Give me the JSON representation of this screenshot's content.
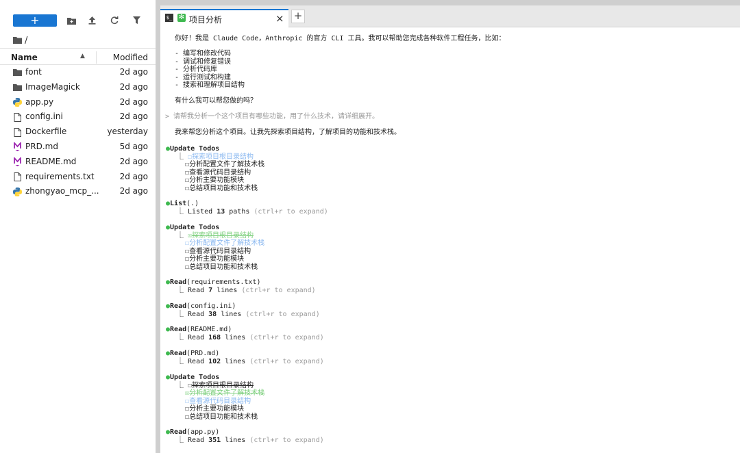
{
  "file_browser": {
    "new_label": "+",
    "breadcrumb": "/",
    "col_name": "Name",
    "col_modified": "Modified",
    "files": [
      {
        "name": "font",
        "icon": "folder-icon",
        "modified": "2d ago"
      },
      {
        "name": "ImageMagick",
        "icon": "folder-icon",
        "modified": "2d ago"
      },
      {
        "name": "app.py",
        "icon": "python-file-icon",
        "modified": "2d ago"
      },
      {
        "name": "config.ini",
        "icon": "file-icon",
        "modified": "2d ago"
      },
      {
        "name": "Dockerfile",
        "icon": "file-icon",
        "modified": "yesterday"
      },
      {
        "name": "PRD.md",
        "icon": "markdown-file-icon",
        "modified": "5d ago"
      },
      {
        "name": "README.md",
        "icon": "markdown-file-icon",
        "modified": "2d ago"
      },
      {
        "name": "requirements.txt",
        "icon": "file-icon",
        "modified": "2d ago"
      },
      {
        "name": "zhongyao_mcp_...",
        "icon": "python-file-icon",
        "modified": "2d ago"
      }
    ]
  },
  "tab": {
    "label": "项目分析",
    "close": "×",
    "add": "+"
  },
  "terminal": {
    "greeting": "你好！我是 Claude Code，Anthropic 的官方 CLI 工具。我可以帮助您完成各种软件工程任务，比如：",
    "abilities": [
      "- 编写和修改代码",
      "- 调试和修复错误",
      "- 分析代码库",
      "- 运行测试和构建",
      "- 搜索和理解项目结构"
    ],
    "ask": "有什么我可以帮您做的吗？",
    "user_prompt": "> 请帮我分析一个这个项目有哪些功能，用了什么技术，请详细展开。",
    "reply": "我来帮您分析这个项目。让我先探索项目结构，了解项目的功能和技术栈。",
    "todos_title": "Update Todos",
    "todo_items": [
      "探索项目根目录结构",
      "分析配置文件了解技术栈",
      "查看源代码目录结构",
      "分析主要功能模块",
      "总结项目功能和技术栈"
    ],
    "list_tool": "List",
    "list_arg": "(.)",
    "list_result_prefix": "Listed ",
    "list_count": "13",
    "list_result_suffix": " paths ",
    "expand_hint": "(ctrl+r to expand)",
    "read_tool": "Read",
    "read_prefix": "Read ",
    "lines_suffix": " lines ",
    "reads": [
      {
        "arg": "(requirements.txt)",
        "count": "7"
      },
      {
        "arg": "(config.ini)",
        "count": "38"
      },
      {
        "arg": "(README.md)",
        "count": "168"
      },
      {
        "arg": "(PRD.md)",
        "count": "102"
      },
      {
        "arg": "(app.py)",
        "count": "351"
      }
    ],
    "box_empty": "☐",
    "box_checked": "☒",
    "branch": "⎿"
  },
  "colors": {
    "accent": "#1976d2",
    "bullet": "#3fb950",
    "in_progress": "#8ab8f0",
    "done": "#7fd07f",
    "hint": "#999999"
  }
}
